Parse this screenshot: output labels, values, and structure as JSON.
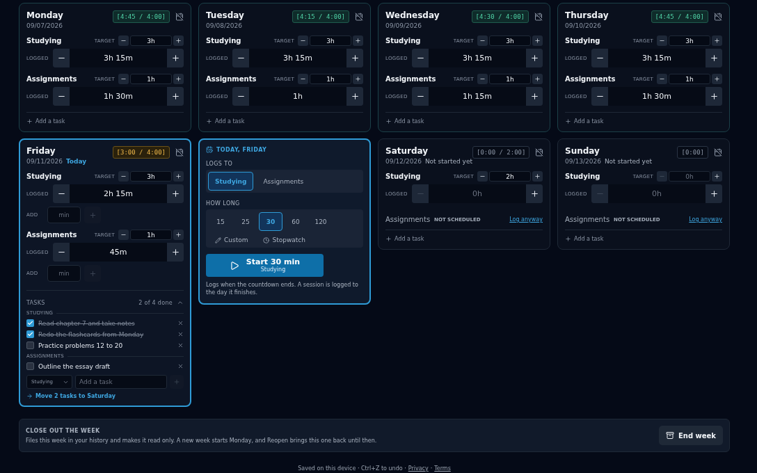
{
  "days": [
    {
      "name": "Monday",
      "date": "09/07/2026",
      "today": false,
      "total": "[4:45 / 4:00]",
      "goal_met": true,
      "categories": [
        {
          "kind": "scheduled",
          "name": "Studying",
          "target_label": "TARGET",
          "target": "3h",
          "can_decrease_target": true,
          "logged_label": "LOGGED",
          "logged": "3h 15m",
          "can_decrease_logged": true
        },
        {
          "kind": "scheduled",
          "name": "Assignments",
          "target_label": "TARGET",
          "target": "1h",
          "can_decrease_target": true,
          "logged_label": "LOGGED",
          "logged": "1h 30m",
          "can_decrease_logged": true
        }
      ],
      "add_task": "Add a task"
    },
    {
      "name": "Tuesday",
      "date": "09/08/2026",
      "today": false,
      "total": "[4:15 / 4:00]",
      "goal_met": true,
      "categories": [
        {
          "kind": "scheduled",
          "name": "Studying",
          "target_label": "TARGET",
          "target": "3h",
          "can_decrease_target": true,
          "logged_label": "LOGGED",
          "logged": "3h 15m",
          "can_decrease_logged": true
        },
        {
          "kind": "scheduled",
          "name": "Assignments",
          "target_label": "TARGET",
          "target": "1h",
          "can_decrease_target": true,
          "logged_label": "LOGGED",
          "logged": "1h",
          "can_decrease_logged": true
        }
      ],
      "add_task": "Add a task"
    },
    {
      "name": "Wednesday",
      "date": "09/09/2026",
      "today": false,
      "total": "[4:30 / 4:00]",
      "goal_met": true,
      "categories": [
        {
          "kind": "scheduled",
          "name": "Studying",
          "target_label": "TARGET",
          "target": "3h",
          "can_decrease_target": true,
          "logged_label": "LOGGED",
          "logged": "3h 15m",
          "can_decrease_logged": true
        },
        {
          "kind": "scheduled",
          "name": "Assignments",
          "target_label": "TARGET",
          "target": "1h",
          "can_decrease_target": true,
          "logged_label": "LOGGED",
          "logged": "1h 15m",
          "can_decrease_logged": true
        }
      ],
      "add_task": "Add a task"
    },
    {
      "name": "Thursday",
      "date": "09/10/2026",
      "today": false,
      "total": "[4:45 / 4:00]",
      "goal_met": true,
      "categories": [
        {
          "kind": "scheduled",
          "name": "Studying",
          "target_label": "TARGET",
          "target": "3h",
          "can_decrease_target": true,
          "logged_label": "LOGGED",
          "logged": "3h 15m",
          "can_decrease_logged": true
        },
        {
          "kind": "scheduled",
          "name": "Assignments",
          "target_label": "TARGET",
          "target": "1h",
          "can_decrease_target": true,
          "logged_label": "LOGGED",
          "logged": "1h 30m",
          "can_decrease_logged": true
        }
      ],
      "add_task": "Add a task"
    },
    {
      "name": "Friday",
      "date": "09/11/2026",
      "status": {
        "kind": "today",
        "text": "Today"
      },
      "today": true,
      "total": "[3:00 / 4:00]",
      "goal_met": false,
      "started": true,
      "categories": [
        {
          "kind": "scheduled",
          "name": "Studying",
          "target_label": "TARGET",
          "target": "3h",
          "can_decrease_target": true,
          "logged_label": "LOGGED",
          "logged": "2h 15m",
          "can_decrease_logged": true,
          "add": {
            "label": "ADD",
            "placeholder": "min",
            "disabled": true
          }
        },
        {
          "kind": "scheduled",
          "name": "Assignments",
          "target_label": "TARGET",
          "target": "1h",
          "can_decrease_target": true,
          "logged_label": "LOGGED",
          "logged": "45m",
          "can_decrease_logged": true,
          "add": {
            "label": "ADD",
            "placeholder": "min",
            "disabled": true
          }
        }
      ],
      "tasks": {
        "label": "TASKS",
        "count": "2 of 4 done",
        "expanded": true,
        "groups": [
          {
            "name": "STUDYING",
            "items": [
              {
                "text": "Read chapter 7 and take notes",
                "checked": true
              },
              {
                "text": "Redo the flashcards from Monday",
                "checked": true
              },
              {
                "text": "Practice problems 12 to 20",
                "checked": false
              }
            ]
          },
          {
            "name": "ASSIGNMENTS",
            "items": [
              {
                "text": "Outline the essay draft",
                "checked": false
              }
            ]
          }
        ],
        "category_select": "Studying",
        "input_placeholder": "Add a task",
        "move_link": "Move 2 tasks to Saturday"
      }
    },
    {
      "kind": "timer",
      "header": "TODAY, FRIDAY",
      "logs_to_label": "LOGS TO",
      "targets": [
        {
          "label": "Studying",
          "selected": true
        },
        {
          "label": "Assignments",
          "selected": false
        }
      ],
      "how_long_label": "HOW LONG",
      "durations": [
        {
          "label": "15",
          "selected": false
        },
        {
          "label": "25",
          "selected": false
        },
        {
          "label": "30",
          "selected": true
        },
        {
          "label": "60",
          "selected": false
        },
        {
          "label": "120",
          "selected": false
        }
      ],
      "modes": [
        {
          "kind": "custom",
          "label": "Custom"
        },
        {
          "kind": "stopwatch",
          "label": "Stopwatch"
        }
      ],
      "start": {
        "title": "Start 30 min",
        "subtitle": "Studying"
      },
      "note": "Logs when the countdown ends. A session is logged to the day it finishes."
    },
    {
      "name": "Saturday",
      "date": "09/12/2026",
      "status": {
        "kind": "idle",
        "text": "Not started yet"
      },
      "today": false,
      "total": "[0:00 / 2:00]",
      "goal_met": false,
      "started": false,
      "categories": [
        {
          "kind": "scheduled",
          "name": "Studying",
          "target_label": "TARGET",
          "target": "2h",
          "can_decrease_target": true,
          "logged_label": "LOGGED",
          "logged": "0h",
          "can_decrease_logged": false
        },
        {
          "kind": "unscheduled",
          "name": "Assignments",
          "note": "NOT SCHEDULED",
          "action": "Log anyway"
        }
      ],
      "add_task": "Add a task"
    },
    {
      "name": "Sunday",
      "date": "09/13/2026",
      "status": {
        "kind": "idle",
        "text": "Not started yet"
      },
      "today": false,
      "total": "[0:00]",
      "goal_met": false,
      "started": false,
      "categories": [
        {
          "kind": "scheduled",
          "name": "Studying",
          "target_label": "TARGET",
          "target": "0h",
          "can_decrease_target": false,
          "logged_label": "LOGGED",
          "logged": "0h",
          "can_decrease_logged": false
        },
        {
          "kind": "unscheduled",
          "name": "Assignments",
          "note": "NOT SCHEDULED",
          "action": "Log anyway"
        }
      ],
      "add_task": "Add a task"
    }
  ],
  "close_week": {
    "title": "CLOSE OUT THE WEEK",
    "text": "Files this week in your history and makes it read only. A new week starts Monday, and Reopen brings this one back until then.",
    "button": "End week"
  },
  "footer": {
    "text": "Saved on this device · Ctrl+Z to undo ·",
    "links": [
      "Privacy",
      "Terms"
    ],
    "separator": "·"
  }
}
